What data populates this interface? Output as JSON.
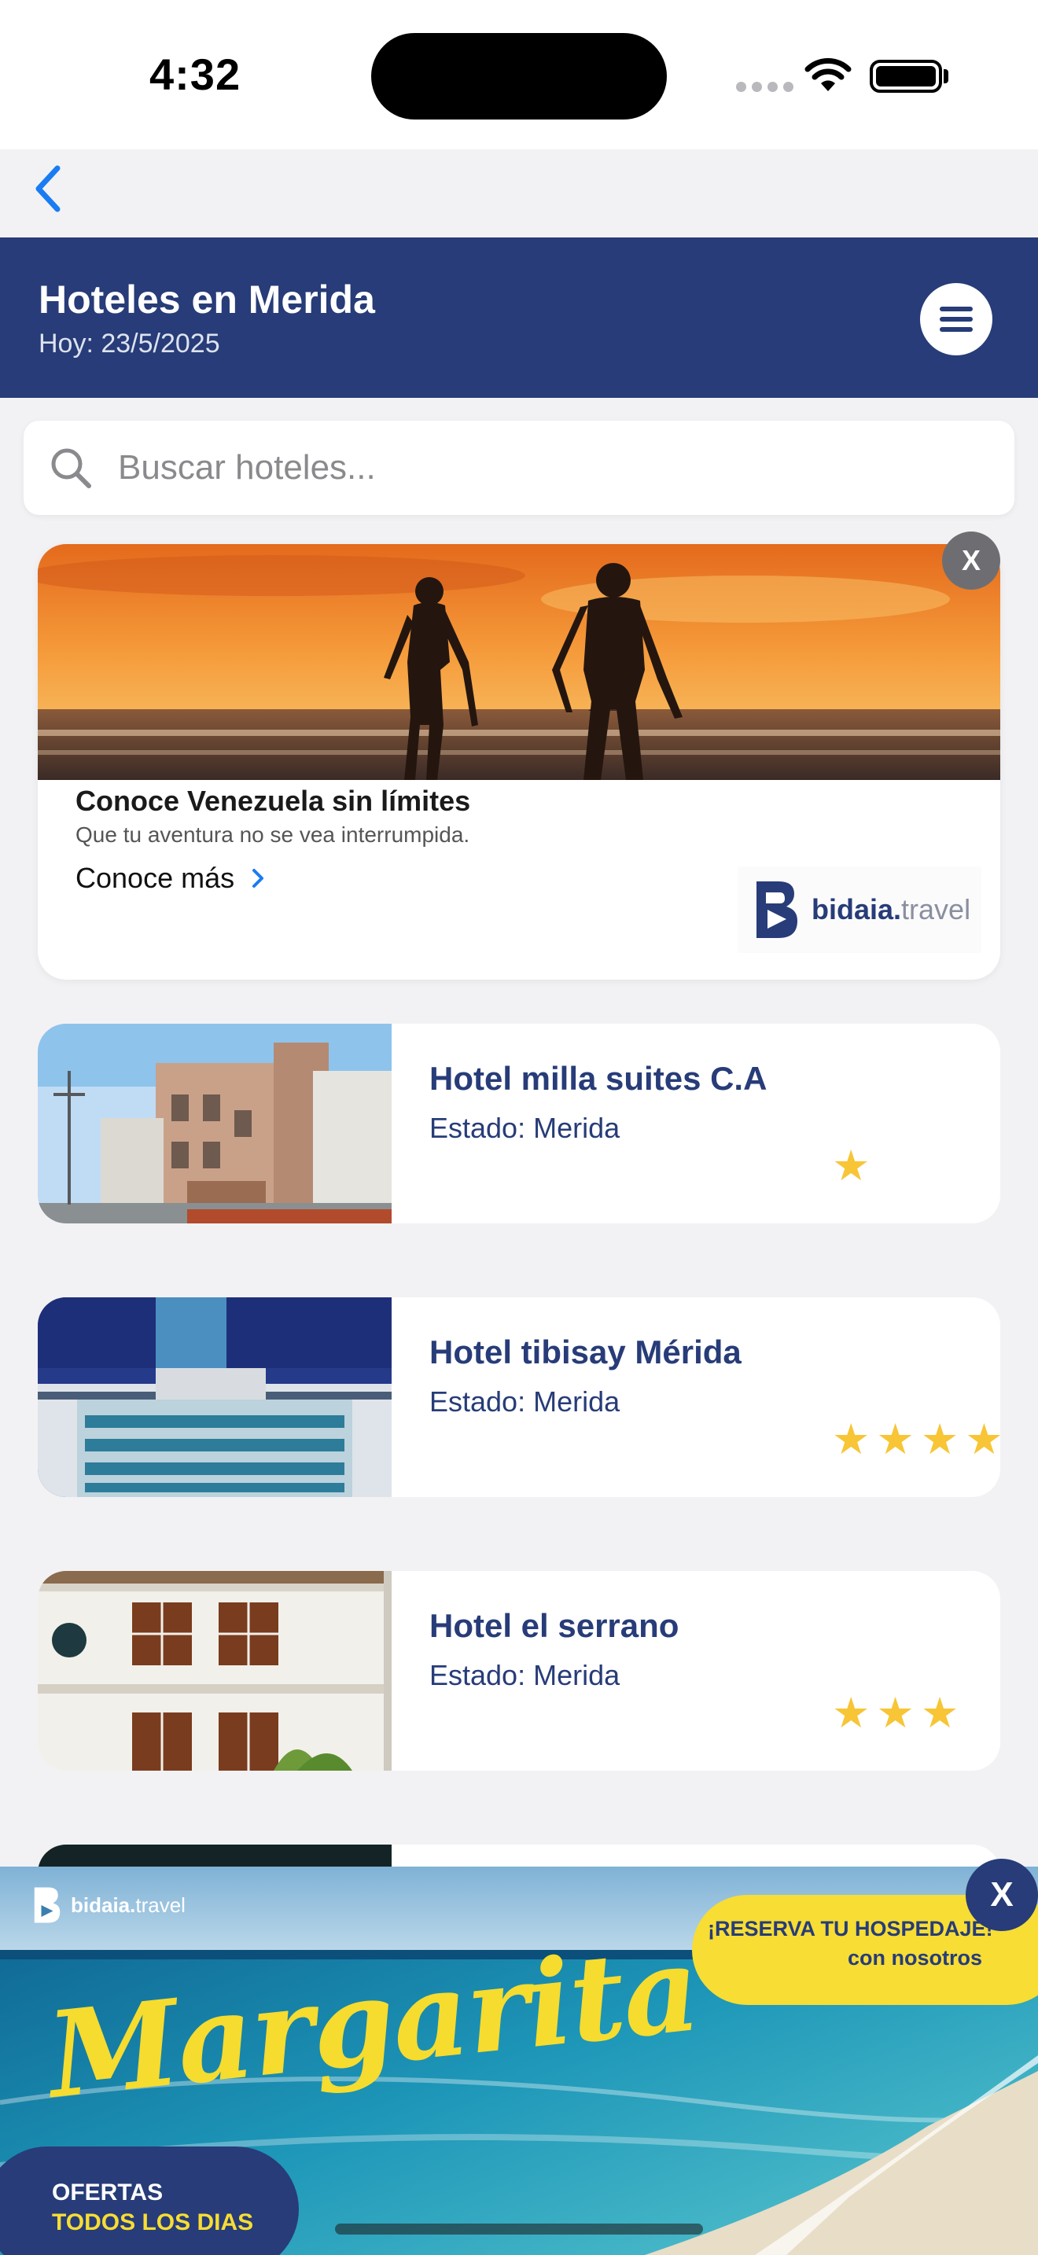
{
  "status_bar": {
    "time": "4:32"
  },
  "header": {
    "title": "Hoteles en Merida",
    "subtitle": "Hoy: 23/5/2025",
    "accent_color": "#273c78"
  },
  "search": {
    "placeholder": "Buscar hoteles..."
  },
  "ad": {
    "title": "Conoce Venezuela sin límites",
    "text": "Que tu aventura no se vea interrumpida.",
    "link_label": "Conoce más",
    "close_label": "X",
    "logo_bold": "bidaia.",
    "logo_light": "travel"
  },
  "hotels": [
    {
      "name": "Hotel milla suites C.A",
      "state": "Estado: Merida",
      "stars": 1
    },
    {
      "name": "Hotel tibisay Mérida",
      "state": "Estado: Merida",
      "stars": 4
    },
    {
      "name": "Hotel el serrano",
      "state": "Estado: Merida",
      "stars": 3
    }
  ],
  "banner": {
    "logo_bold": "bidaia.",
    "logo_light": "travel",
    "headline": "Margarita",
    "pill_line1": "¡RESERVA TU HOSPEDAJE!",
    "pill_line2": "con nosotros",
    "offers_line1": "OFERTAS",
    "offers_line2": "TODOS LOS DIAS",
    "close_label": "X"
  },
  "colors": {
    "star": "#f7c536",
    "banner_yellow": "#f7dd34",
    "navy": "#273c78"
  }
}
